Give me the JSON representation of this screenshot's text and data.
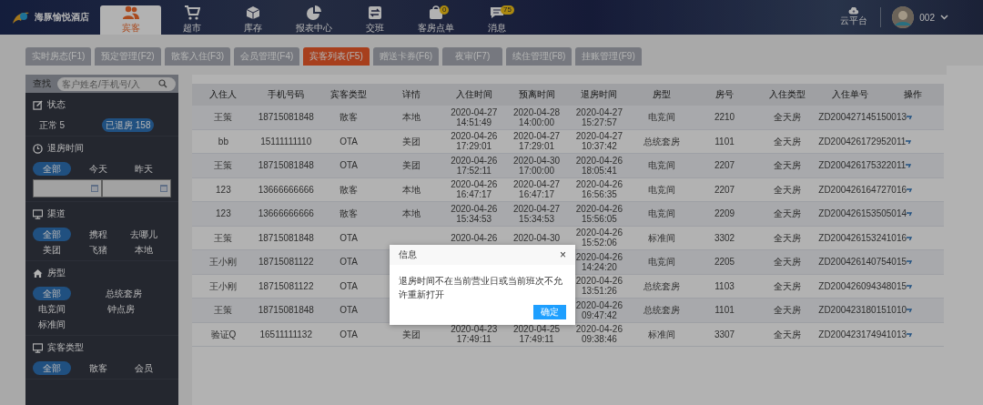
{
  "brand": {
    "name": "海豚愉悦酒店"
  },
  "nav": [
    {
      "label": "宾客",
      "selected": true
    },
    {
      "label": "超市",
      "selected": false
    },
    {
      "label": "库存",
      "selected": false
    },
    {
      "label": "报表中心",
      "selected": false
    },
    {
      "label": "交班",
      "selected": false
    },
    {
      "label": "客房点单",
      "selected": false,
      "badge": "0"
    },
    {
      "label": "消息",
      "selected": false,
      "badge": "75"
    }
  ],
  "cloud": {
    "label": "云平台"
  },
  "user": {
    "name": "002"
  },
  "tabs": [
    {
      "label": "实时房态(F1)",
      "selected": false
    },
    {
      "label": "预定管理(F2)",
      "selected": false
    },
    {
      "label": "散客入住(F3)",
      "selected": false
    },
    {
      "label": "会员管理(F4)",
      "selected": false
    },
    {
      "label": "宾客列表(F5)",
      "selected": true
    },
    {
      "label": "赠送卡券(F6)",
      "selected": false
    },
    {
      "label": "夜审(F7)",
      "selected": false
    },
    {
      "label": "续住管理(F8)",
      "selected": false
    },
    {
      "label": "挂账管理(F9)",
      "selected": false
    }
  ],
  "sidebar": {
    "search_label": "查找",
    "search": {
      "placeholder": "客户姓名/手机号/入"
    },
    "sections": [
      {
        "title": "状态",
        "options": [
          {
            "label": "正常 5",
            "selected": false
          },
          {
            "label": "已退房 158",
            "selected": true
          }
        ]
      },
      {
        "title": "退房时间",
        "dates": true,
        "options": [
          {
            "label": "全部",
            "selected": true
          },
          {
            "label": "今天",
            "selected": false
          },
          {
            "label": "昨天",
            "selected": false
          }
        ]
      },
      {
        "title": "渠道",
        "options": [
          {
            "label": "全部",
            "selected": true
          },
          {
            "label": "携程",
            "selected": false
          },
          {
            "label": "去哪儿",
            "selected": false
          },
          {
            "label": "美团",
            "selected": false
          },
          {
            "label": "飞猪",
            "selected": false
          },
          {
            "label": "本地",
            "selected": false
          }
        ]
      },
      {
        "title": "房型",
        "options": [
          {
            "label": "全部",
            "selected": true
          },
          {
            "label": "总统套房",
            "selected": false
          },
          {
            "label": "电竞间",
            "selected": false
          },
          {
            "label": "钟点房",
            "selected": false
          },
          {
            "label": "标准间",
            "selected": false
          }
        ]
      },
      {
        "title": "宾客类型",
        "options": [
          {
            "label": "全部",
            "selected": true
          },
          {
            "label": "散客",
            "selected": false
          },
          {
            "label": "会员",
            "selected": false
          }
        ]
      }
    ]
  },
  "table": {
    "columns": [
      "入住人",
      "手机号码",
      "宾客类型",
      "详情",
      "入住时间",
      "预离时间",
      "退房时间",
      "房型",
      "房号",
      "入住类型",
      "入住单号",
      "操作"
    ],
    "rows": [
      [
        "王策",
        "18715081848",
        "散客",
        "本地",
        "2020-04-27 14:51:49",
        "2020-04-28 14:00:00",
        "2020-04-27 15:27:57",
        "电竞间",
        "2210",
        "全天房",
        "ZD200427145150013"
      ],
      [
        "bb",
        "15111111110",
        "OTA",
        "美团",
        "2020-04-26 17:29:01",
        "2020-04-27 17:29:01",
        "2020-04-27 10:37:42",
        "总统套房",
        "1101",
        "全天房",
        "ZD200426172952011"
      ],
      [
        "王策",
        "18715081848",
        "OTA",
        "美团",
        "2020-04-26 17:52:11",
        "2020-04-30 17:00:00",
        "2020-04-26 18:05:41",
        "电竞间",
        "2207",
        "全天房",
        "ZD200426175322011"
      ],
      [
        "123",
        "13666666666",
        "散客",
        "本地",
        "2020-04-26 16:47:17",
        "2020-04-27 16:47:17",
        "2020-04-26 16:56:35",
        "电竞间",
        "2207",
        "全天房",
        "ZD200426164727016"
      ],
      [
        "123",
        "13666666666",
        "散客",
        "本地",
        "2020-04-26 15:34:53",
        "2020-04-27 15:34:53",
        "2020-04-26 15:56:05",
        "电竞间",
        "2209",
        "全天房",
        "ZD200426153505014"
      ],
      [
        "王策",
        "18715081848",
        "OTA",
        null,
        "2020-04-26",
        "2020-04-30",
        "2020-04-26 15:52:06",
        "标准间",
        "3302",
        "全天房",
        "ZD200426153241016"
      ],
      [
        "王小刚",
        "18715081122",
        "OTA",
        null,
        null,
        null,
        "2020-04-26 14:24:20",
        "电竞间",
        "2205",
        "全天房",
        "ZD200426140754015"
      ],
      [
        "王小刚",
        "18715081122",
        "OTA",
        null,
        null,
        null,
        "2020-04-26 13:51:26",
        "总统套房",
        "1103",
        "全天房",
        "ZD200426094348015"
      ],
      [
        "王策",
        "18715081848",
        "OTA",
        null,
        null,
        null,
        "2020-04-26 09:47:42",
        "总统套房",
        "1101",
        "全天房",
        "ZD200423180151010"
      ],
      [
        "验证Q",
        "16511111132",
        "OTA",
        "美团",
        "2020-04-23 17:49:11",
        "2020-04-25 17:49:11",
        "2020-04-26 09:38:46",
        "标准间",
        "3307",
        "全天房",
        "ZD200423174941013"
      ]
    ]
  },
  "dialog": {
    "title": "信息",
    "close": "×",
    "message": "退房时间不在当前营业日或当前班次不允许重新打开",
    "button": "确定"
  }
}
